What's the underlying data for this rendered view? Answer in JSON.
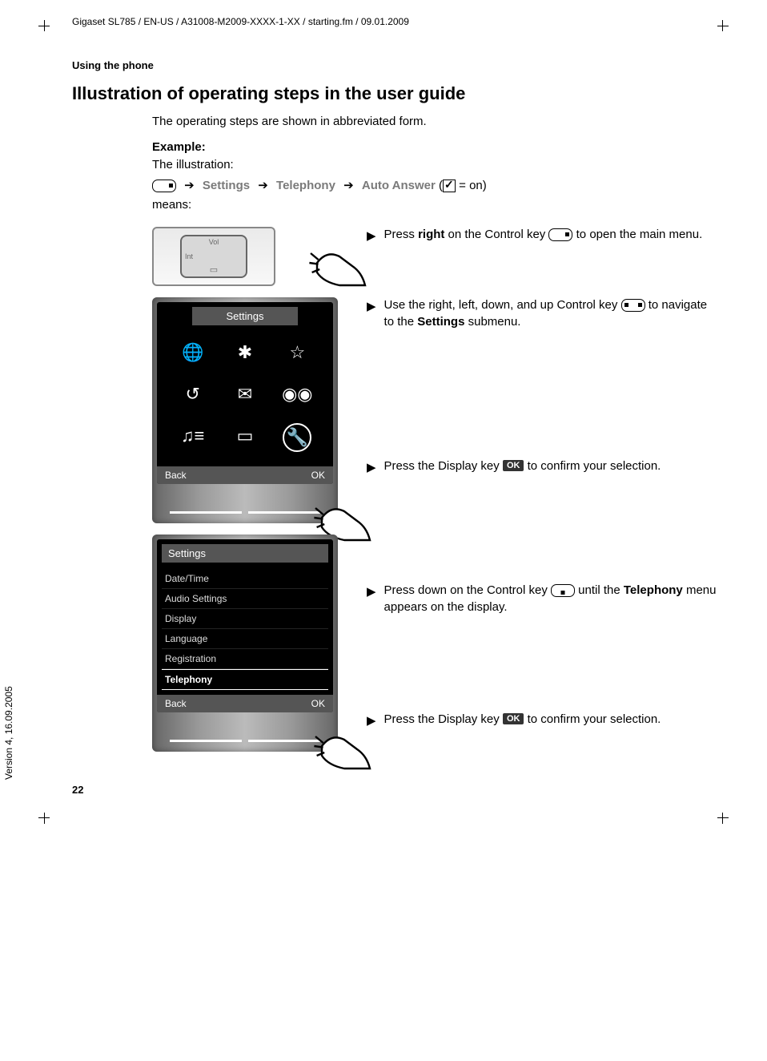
{
  "header": "Gigaset SL785 / EN-US / A31008-M2009-XXXX-1-XX / starting.fm / 09.01.2009",
  "section_label": "Using the phone",
  "heading": "Illustration of operating steps in the user guide",
  "intro": "The operating steps are shown in abbreviated form.",
  "example_label": "Example:",
  "illustration_label": "The illustration:",
  "nav": {
    "settings": "Settings",
    "telephony": "Telephony",
    "auto_answer": "Auto Answer",
    "on_suffix": " = on)"
  },
  "means": "means:",
  "control_key": {
    "top": "Vol",
    "left": "Int",
    "bottom": "▭"
  },
  "steps": {
    "s1a": "Press ",
    "s1_bold": "right",
    "s1b": " on the Control key ",
    "s1c": " to open the main menu.",
    "s2a": "Use the right, left, down, and up Control key ",
    "s2b": " to navigate to the ",
    "s2_gray": "Settings",
    "s2c": " submenu.",
    "s3a": "Press the Display key ",
    "s3b": " to confirm your selection.",
    "s4a": "Press down on the Control key ",
    "s4b": " until the ",
    "s4_gray": "Telephony",
    "s4c": " menu appears on the display.",
    "s5a": "Press the Display key ",
    "s5b": " to confirm your selection."
  },
  "ok_label": "OK",
  "phone1": {
    "title": "Settings",
    "back": "Back",
    "ok": "OK"
  },
  "phone2": {
    "title": "Settings",
    "items": [
      "Date/Time",
      "Audio Settings",
      "Display",
      "Language",
      "Registration",
      "Telephony"
    ],
    "back": "Back",
    "ok": "OK"
  },
  "page_number": "22",
  "side_note": "Version 4, 16.09.2005"
}
